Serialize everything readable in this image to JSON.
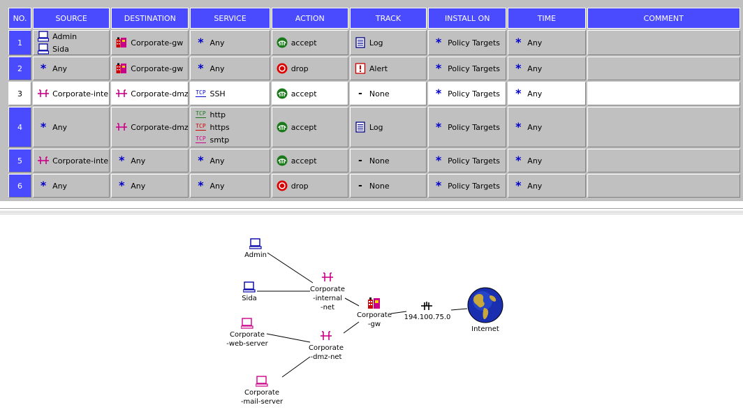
{
  "columns": {
    "no": "NO.",
    "source": "SOURCE",
    "destination": "DESTINATION",
    "service": "SERVICE",
    "action": "ACTION",
    "track": "TRACK",
    "install_on": "INSTALL ON",
    "time": "TIME",
    "comment": "COMMENT"
  },
  "rules": [
    {
      "no": "1",
      "source": [
        "Admin",
        "Sida"
      ],
      "destination": [
        "Corporate-gw"
      ],
      "service": [
        "Any"
      ],
      "action": "accept",
      "track": "Log",
      "install_on": "Policy Targets",
      "time": "Any",
      "comment": ""
    },
    {
      "no": "2",
      "source": [
        "Any"
      ],
      "destination": [
        "Corporate-gw"
      ],
      "service": [
        "Any"
      ],
      "action": "drop",
      "track": "Alert",
      "install_on": "Policy Targets",
      "time": "Any",
      "comment": ""
    },
    {
      "no": "3",
      "source": [
        "Corporate-internal-net"
      ],
      "destination": [
        "Corporate-dmz-net"
      ],
      "service": [
        "SSH"
      ],
      "action": "accept",
      "track": "None",
      "install_on": "Policy Targets",
      "time": "Any",
      "comment": ""
    },
    {
      "no": "4",
      "source": [
        "Any"
      ],
      "destination": [
        "Corporate-dmz-net"
      ],
      "service": [
        "http",
        "https",
        "smtp"
      ],
      "action": "accept",
      "track": "Log",
      "install_on": "Policy Targets",
      "time": "Any",
      "comment": ""
    },
    {
      "no": "5",
      "source": [
        "Corporate-internal-net"
      ],
      "destination": [
        "Any"
      ],
      "service": [
        "Any"
      ],
      "action": "accept",
      "track": "None",
      "install_on": "Policy Targets",
      "time": "Any",
      "comment": ""
    },
    {
      "no": "6",
      "source": [
        "Any"
      ],
      "destination": [
        "Any"
      ],
      "service": [
        "Any"
      ],
      "action": "drop",
      "track": "None",
      "install_on": "Policy Targets",
      "time": "Any",
      "comment": ""
    }
  ],
  "icons": {
    "host": "host-icon",
    "network": "network-icon",
    "gateway": "gateway-icon",
    "any": "any-star-icon",
    "tcp": "tcp-service-icon",
    "accept": "accept-icon",
    "drop": "drop-icon",
    "log": "log-icon",
    "alert": "alert-icon",
    "none": "none-dash-icon",
    "globe": "globe-icon",
    "router": "router-icon"
  },
  "colors": {
    "header_bg": "#4a4aff",
    "panel_bg": "#c0c0c0",
    "network": "#cc0088",
    "host": "#0000aa",
    "accept": "#1a7a1a",
    "drop": "#dd0000",
    "alert": "#cc0000",
    "any_star": "#0000cc"
  },
  "topology": {
    "nodes": {
      "admin": "Admin",
      "sida": "Sida",
      "web_server": [
        "Corporate",
        "-web-server"
      ],
      "mail_server": [
        "Corporate",
        "-mail-server"
      ],
      "internal_net": [
        "Corporate",
        "-internal",
        "-net"
      ],
      "dmz_net": [
        "Corporate",
        "-dmz-net"
      ],
      "gateway": [
        "Corporate",
        "-gw"
      ],
      "router": "194.100.75.0",
      "internet": "Internet"
    }
  }
}
